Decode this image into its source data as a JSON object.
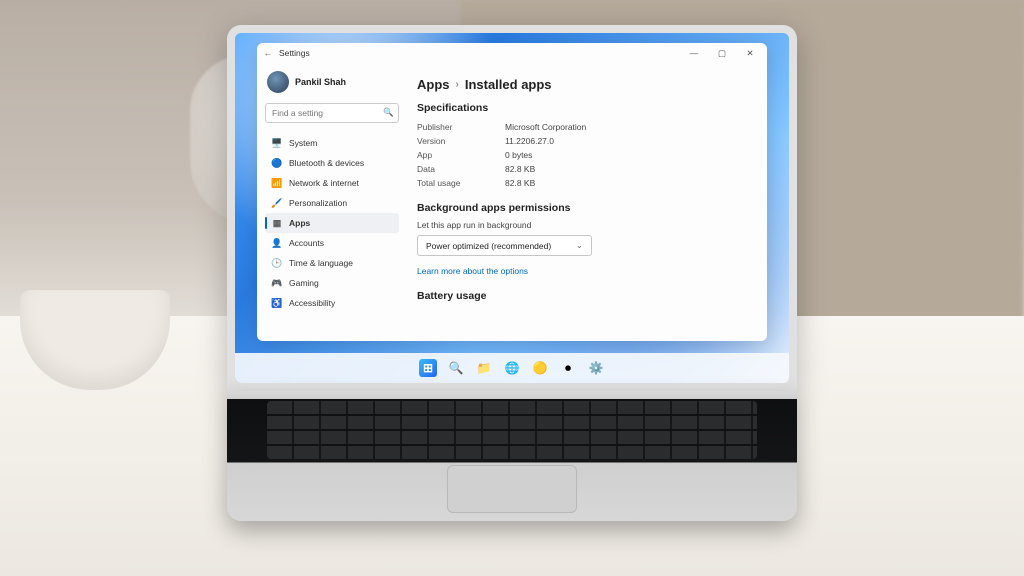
{
  "window": {
    "title": "Settings",
    "user_name": "Pankil Shah",
    "search_placeholder": "Find a setting"
  },
  "sidebar": {
    "items": [
      {
        "label": "System",
        "icon": "🖥️",
        "icon_name": "system-icon",
        "color": "#1f67d2"
      },
      {
        "label": "Bluetooth & devices",
        "icon": "🔵",
        "icon_name": "bluetooth-icon",
        "color": "#3a7bd5"
      },
      {
        "label": "Network & internet",
        "icon": "📶",
        "icon_name": "network-icon",
        "color": "#13a4ec"
      },
      {
        "label": "Personalization",
        "icon": "🖌️",
        "icon_name": "personalization-icon",
        "color": "#5b5b5b"
      },
      {
        "label": "Apps",
        "icon": "▦",
        "icon_name": "apps-icon",
        "color": "#5b5b5b",
        "selected": true
      },
      {
        "label": "Accounts",
        "icon": "👤",
        "icon_name": "accounts-icon",
        "color": "#2fb36a"
      },
      {
        "label": "Time & language",
        "icon": "🕒",
        "icon_name": "time-language-icon",
        "color": "#4aa0e6"
      },
      {
        "label": "Gaming",
        "icon": "🎮",
        "icon_name": "gaming-icon",
        "color": "#3c4351"
      },
      {
        "label": "Accessibility",
        "icon": "♿",
        "icon_name": "accessibility-icon",
        "color": "#1a73e8"
      }
    ]
  },
  "breadcrumb": {
    "parent": "Apps",
    "current": "Installed apps"
  },
  "sections": {
    "specs_title": "Specifications",
    "specs": [
      {
        "k": "Publisher",
        "v": "Microsoft Corporation"
      },
      {
        "k": "Version",
        "v": "11.2206.27.0"
      },
      {
        "k": "App",
        "v": "0 bytes"
      },
      {
        "k": "Data",
        "v": "82.8 KB"
      },
      {
        "k": "Total usage",
        "v": "82.8 KB"
      }
    ],
    "bg_title": "Background apps permissions",
    "bg_label": "Let this app run in background",
    "bg_dropdown": "Power optimized (recommended)",
    "bg_link": "Learn more about the options",
    "battery_title": "Battery usage"
  },
  "taskbar": {
    "items": [
      {
        "name": "start-button",
        "glyph": "⊞"
      },
      {
        "name": "search-button",
        "glyph": "🔍"
      },
      {
        "name": "explorer-button",
        "glyph": "📁"
      },
      {
        "name": "edge-button",
        "glyph": "🌐"
      },
      {
        "name": "chrome-button",
        "glyph": "🟡"
      },
      {
        "name": "media-button",
        "glyph": "⏺"
      },
      {
        "name": "settings-button",
        "glyph": "⚙️"
      }
    ]
  }
}
